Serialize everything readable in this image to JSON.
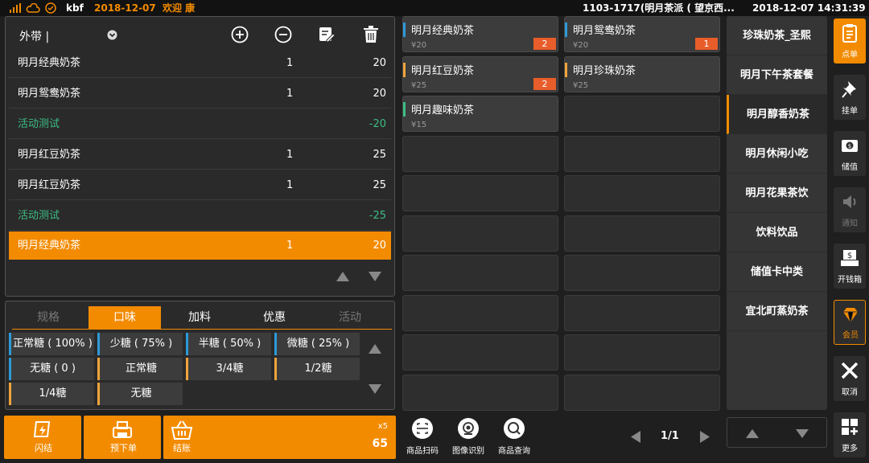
{
  "topbar": {
    "user": "kbf",
    "date": "2018-12-07",
    "greeting": "欢迎 康",
    "store": "1103-1717(明月茶派 ( 望京西...",
    "datetime": "2018-12-07 14:31:39"
  },
  "order": {
    "mode": "外带 |",
    "items": [
      {
        "name": "明月经典奶茶",
        "qty": "1",
        "price": "20",
        "type": "normal"
      },
      {
        "name": "明月鸳鸯奶茶",
        "qty": "1",
        "price": "20",
        "type": "normal"
      },
      {
        "name": "活动测试",
        "qty": "",
        "price": "-20",
        "type": "promo"
      },
      {
        "name": "明月红豆奶茶",
        "qty": "1",
        "price": "25",
        "type": "normal"
      },
      {
        "name": "明月红豆奶茶",
        "qty": "1",
        "price": "25",
        "type": "normal"
      },
      {
        "name": "活动测试",
        "qty": "",
        "price": "-25",
        "type": "promo"
      },
      {
        "name": "明月经典奶茶",
        "qty": "1",
        "price": "20",
        "type": "selected"
      }
    ]
  },
  "options": {
    "tabs": [
      "规格",
      "口味",
      "加料",
      "优惠",
      "活动"
    ],
    "active_tab": "口味",
    "buttons": [
      "正常糖 ( 100% )",
      "少糖 ( 75% )",
      "半糖 ( 50% )",
      "微糖 ( 25% )",
      "无糖 ( 0 )",
      "正常糖",
      "3/4糖",
      "1/2糖",
      "1/4糖",
      "无糖"
    ]
  },
  "actions": {
    "flash": "闪结",
    "preorder": "预下单",
    "checkout": "结账",
    "count": "x5",
    "total": "65"
  },
  "products": [
    {
      "name": "明月经典奶茶",
      "price": "¥20",
      "badge": "2",
      "bar": "#2d9ad8"
    },
    {
      "name": "明月鸳鸯奶茶",
      "price": "¥20",
      "badge": "1",
      "bar": "#2d9ad8"
    },
    {
      "name": "明月红豆奶茶",
      "price": "¥25",
      "badge": "2",
      "bar": "#f0a43c"
    },
    {
      "name": "明月珍珠奶茶",
      "price": "¥25",
      "badge": "",
      "bar": "#f0a43c"
    },
    {
      "name": "明月趣味奶茶",
      "price": "¥15",
      "badge": "",
      "bar": "#3dbd85"
    }
  ],
  "categories": [
    "珍珠奶茶_圣熙",
    "明月下午茶套餐",
    "明月醇香奶茶",
    "明月休闲小吃",
    "明月花果茶饮",
    "饮料饮品",
    "储值卡中类",
    "宜北町蒸奶茶"
  ],
  "active_category": "明月醇香奶茶",
  "tools": [
    "商品扫码",
    "图像识别",
    "商品查询"
  ],
  "pager": "1/1",
  "nav": [
    "点单",
    "挂单",
    "储值",
    "通知",
    "开钱箱",
    "会员",
    "取消",
    "更多"
  ],
  "colors": {
    "accent": "#f38b00",
    "promo": "#3dbd85",
    "badge": "#e85d2a"
  }
}
